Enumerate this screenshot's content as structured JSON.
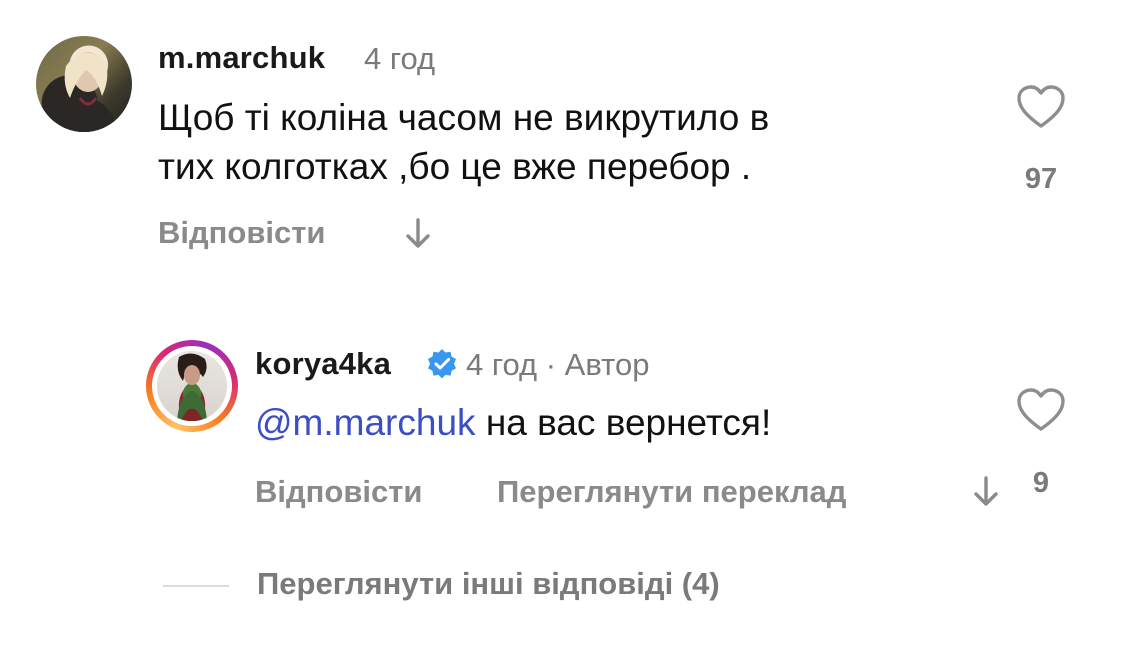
{
  "comments": [
    {
      "username": "m.marchuk",
      "time": "4 год",
      "text_line1": "Щоб ті коліна часом не викрутило в",
      "text_line2": "тих колготках ,бо це вже перебор .",
      "reply_label": "Відповісти",
      "likes": "97"
    },
    {
      "username": "korya4ka",
      "verified": true,
      "time": "4 год · Автор",
      "mention": "@m.marchuk",
      "text": "на вас вернется!",
      "reply_label": "Відповісти",
      "translate_label": "Переглянути переклад",
      "likes": "9"
    }
  ],
  "view_more_replies": "Переглянути інші відповіді (4)",
  "colors": {
    "mention": "#3b4fc4",
    "verified_badge": "#3897f0",
    "secondary_text": "#8a8a8a"
  },
  "icons": [
    "heart-icon",
    "down-arrow-icon",
    "verified-badge-icon"
  ]
}
